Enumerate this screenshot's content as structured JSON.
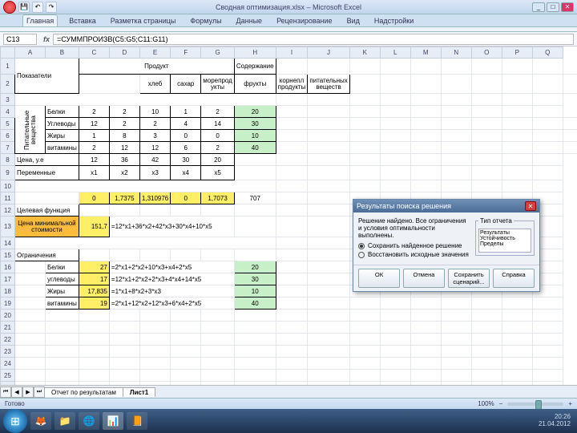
{
  "window": {
    "title": "Сводная оптимизация.xlsx – Microsoft Excel"
  },
  "ribbon": {
    "tabs": [
      "Главная",
      "Вставка",
      "Разметка страницы",
      "Формулы",
      "Данные",
      "Рецензирование",
      "Вид",
      "Надстройки"
    ],
    "active": 0
  },
  "formula_bar": {
    "name_box": "C13",
    "formula": "=СУММПРОИЗВ(C5:G5;C11:G11)"
  },
  "grid": {
    "col_headers": [
      "",
      "A",
      "B",
      "C",
      "D",
      "E",
      "F",
      "G",
      "H",
      "I",
      "J",
      "K",
      "L",
      "M",
      "N",
      "O",
      "P",
      "Q"
    ],
    "rows": [
      {
        "n": "1",
        "h": 20,
        "cells": [
          {
            "t": "Показатели",
            "cls": "bord lbl",
            "cs": 2,
            "rs": 2
          },
          {
            "t": "Продукт",
            "cls": "bord ctr",
            "cs": 5
          },
          {
            "t": "Содержание",
            "cls": "bord lbl",
            "rs": 1
          }
        ]
      },
      {
        "n": "2",
        "h": 24,
        "cells": [
          {
            "t": "",
            "cs": 2
          },
          {
            "t": "хлеб",
            "cls": "bord ctr"
          },
          {
            "t": "сахар",
            "cls": "bord ctr"
          },
          {
            "t": "морепрод\nукты",
            "cls": "bord ctr"
          },
          {
            "t": "фрукты",
            "cls": "bord ctr"
          },
          {
            "t": "корнепл\nпродукты",
            "cls": "bord ctr"
          },
          {
            "t": "питательных\nвеществ",
            "cls": "bord ctr"
          }
        ]
      },
      {
        "n": "3",
        "h": 8,
        "cells": [
          {
            "t": "",
            "cs": 8
          }
        ]
      },
      {
        "n": "4",
        "h": 15,
        "cells": [
          {
            "t": "Питательные\nвещества",
            "cls": "bord rot",
            "rs": 4
          },
          {
            "t": "Белки",
            "cls": "bord lbl"
          },
          {
            "t": "2",
            "cls": "bord ctr"
          },
          {
            "t": "2",
            "cls": "bord ctr"
          },
          {
            "t": "10",
            "cls": "bord ctr"
          },
          {
            "t": "1",
            "cls": "bord ctr"
          },
          {
            "t": "2",
            "cls": "bord ctr"
          },
          {
            "t": "20",
            "cls": "bord green ctr"
          }
        ]
      },
      {
        "n": "5",
        "h": 15,
        "cells": [
          {
            "t": "Углеводы",
            "cls": "bord lbl"
          },
          {
            "t": "12",
            "cls": "bord ctr"
          },
          {
            "t": "2",
            "cls": "bord ctr"
          },
          {
            "t": "2",
            "cls": "bord ctr"
          },
          {
            "t": "4",
            "cls": "bord ctr"
          },
          {
            "t": "14",
            "cls": "bord ctr"
          },
          {
            "t": "30",
            "cls": "bord green ctr"
          }
        ]
      },
      {
        "n": "6",
        "h": 15,
        "cells": [
          {
            "t": "Жиры",
            "cls": "bord lbl"
          },
          {
            "t": "1",
            "cls": "bord ctr"
          },
          {
            "t": "8",
            "cls": "bord ctr"
          },
          {
            "t": "3",
            "cls": "bord ctr"
          },
          {
            "t": "0",
            "cls": "bord ctr"
          },
          {
            "t": "0",
            "cls": "bord ctr"
          },
          {
            "t": "10",
            "cls": "bord green ctr"
          }
        ]
      },
      {
        "n": "7",
        "h": 15,
        "cells": [
          {
            "t": "витамины",
            "cls": "bord lbl"
          },
          {
            "t": "2",
            "cls": "bord ctr"
          },
          {
            "t": "12",
            "cls": "bord ctr"
          },
          {
            "t": "12",
            "cls": "bord ctr"
          },
          {
            "t": "6",
            "cls": "bord ctr"
          },
          {
            "t": "2",
            "cls": "bord ctr"
          },
          {
            "t": "40",
            "cls": "bord green ctr"
          }
        ]
      },
      {
        "n": "8",
        "h": 15,
        "cells": [
          {
            "t": "Цена, у.е",
            "cls": "bord lbl",
            "cs": 2
          },
          {
            "t": "12",
            "cls": "bord ctr"
          },
          {
            "t": "36",
            "cls": "bord ctr"
          },
          {
            "t": "42",
            "cls": "bord ctr"
          },
          {
            "t": "30",
            "cls": "bord ctr"
          },
          {
            "t": "20",
            "cls": "bord ctr"
          },
          {
            "t": ""
          }
        ]
      },
      {
        "n": "9",
        "h": 18,
        "cells": [
          {
            "t": "Переменные",
            "cls": "bord lbl",
            "cs": 2
          },
          {
            "t": "x1",
            "cls": "bord ctr"
          },
          {
            "t": "x2",
            "cls": "bord ctr"
          },
          {
            "t": "x3",
            "cls": "bord ctr"
          },
          {
            "t": "x4",
            "cls": "bord ctr"
          },
          {
            "t": "x5",
            "cls": "bord ctr"
          }
        ]
      },
      {
        "n": "10",
        "h": 8,
        "cells": [
          {
            "t": "",
            "cs": 8
          }
        ]
      },
      {
        "n": "11",
        "h": 15,
        "cells": [
          {
            "t": "",
            "cs": 2
          },
          {
            "t": "0",
            "cls": "bord yellow ctr"
          },
          {
            "t": "1,7375",
            "cls": "bord yellow ctr"
          },
          {
            "t": "1,310976",
            "cls": "bord yellow ctr"
          },
          {
            "t": "0",
            "cls": "bord yellow ctr"
          },
          {
            "t": "1,7073",
            "cls": "bord yellow ctr"
          },
          {
            "t": "707",
            "cls": "ctr"
          }
        ]
      },
      {
        "n": "12",
        "h": 15,
        "cells": [
          {
            "t": "Целевая функция",
            "cls": "bord lbl",
            "cs": 2
          }
        ]
      },
      {
        "n": "13",
        "h": 26,
        "cells": [
          {
            "t": "Цена минимальной\nстоимости",
            "cls": "bord orange ctr",
            "cs": 2
          },
          {
            "t": "151,7",
            "cls": "bord yellow num"
          },
          {
            "t": "=12*x1+36*x2+42*x3+30*x4+10*x5",
            "cls": "lbl",
            "cs": 4
          }
        ]
      },
      {
        "n": "14",
        "h": 10,
        "cells": [
          {
            "t": "",
            "cs": 8
          }
        ]
      },
      {
        "n": "15",
        "h": 12,
        "cells": [
          {
            "t": "Ограничения",
            "cls": "bord lbl",
            "cs": 2
          }
        ]
      },
      {
        "n": "16",
        "h": 14,
        "cells": [
          {
            "t": "",
            "cs": 1
          },
          {
            "t": "Белки",
            "cls": "bord lbl"
          },
          {
            "t": "27",
            "cls": "bord yellow num"
          },
          {
            "t": "=2*x1+2*x2+10*x3+x4+2*x5",
            "cls": "lbl",
            "cs": 4
          },
          {
            "t": "20",
            "cls": "bord green ctr"
          }
        ]
      },
      {
        "n": "17",
        "h": 14,
        "cells": [
          {
            "t": "",
            "cs": 1
          },
          {
            "t": "углеводы",
            "cls": "bord lbl"
          },
          {
            "t": "17",
            "cls": "bord yellow num"
          },
          {
            "t": "=12*x1+2*x2+2*x3+4*x4+14*x5",
            "cls": "lbl",
            "cs": 4
          },
          {
            "t": "30",
            "cls": "bord green ctr"
          }
        ]
      },
      {
        "n": "18",
        "h": 14,
        "cells": [
          {
            "t": "",
            "cs": 1
          },
          {
            "t": "Жиры",
            "cls": "bord lbl"
          },
          {
            "t": "17,835",
            "cls": "bord yellow num"
          },
          {
            "t": "=1*x1+8*x2+3*x3",
            "cls": "lbl",
            "cs": 4
          },
          {
            "t": "10",
            "cls": "bord green ctr"
          }
        ]
      },
      {
        "n": "19",
        "h": 14,
        "cells": [
          {
            "t": "",
            "cs": 1
          },
          {
            "t": "витамины",
            "cls": "bord lbl"
          },
          {
            "t": "19",
            "cls": "bord yellow num"
          },
          {
            "t": "=2*x1+12*x2+12*x3+6*x4+2*x5",
            "cls": "lbl",
            "cs": 4
          },
          {
            "t": "40",
            "cls": "bord green ctr"
          }
        ]
      },
      {
        "n": "20",
        "h": 14,
        "cells": [
          {
            "t": ""
          }
        ]
      },
      {
        "n": "21",
        "h": 14,
        "cells": [
          {
            "t": ""
          }
        ]
      },
      {
        "n": "22",
        "h": 14,
        "cells": [
          {
            "t": ""
          }
        ]
      },
      {
        "n": "23",
        "h": 14,
        "cells": [
          {
            "t": ""
          }
        ]
      },
      {
        "n": "24",
        "h": 14,
        "cells": [
          {
            "t": ""
          }
        ]
      },
      {
        "n": "25",
        "h": 14,
        "cells": [
          {
            "t": ""
          }
        ]
      },
      {
        "n": "26",
        "h": 14,
        "cells": [
          {
            "t": ""
          }
        ]
      }
    ]
  },
  "sheets": {
    "tabs": [
      "Отчет по результатам",
      "Лист1"
    ],
    "active": 1
  },
  "statusbar": {
    "ready": "Готово",
    "zoom": "100%"
  },
  "dialog": {
    "title": "Результаты поиска решения",
    "desc": "Решение найдено. Все ограничения и условия оптимальности выполнены.",
    "radio1": "Сохранить найденное решение",
    "radio2": "Восстановить исходные значения",
    "reports": "Тип отчета",
    "report_items": [
      "Результаты",
      "Устойчивость",
      "Пределы"
    ],
    "buttons": [
      "ОК",
      "Отмена",
      "Сохранить сценарий...",
      "Справка"
    ]
  },
  "taskbar": {
    "time": "20:26",
    "date": "21.04.2012"
  }
}
